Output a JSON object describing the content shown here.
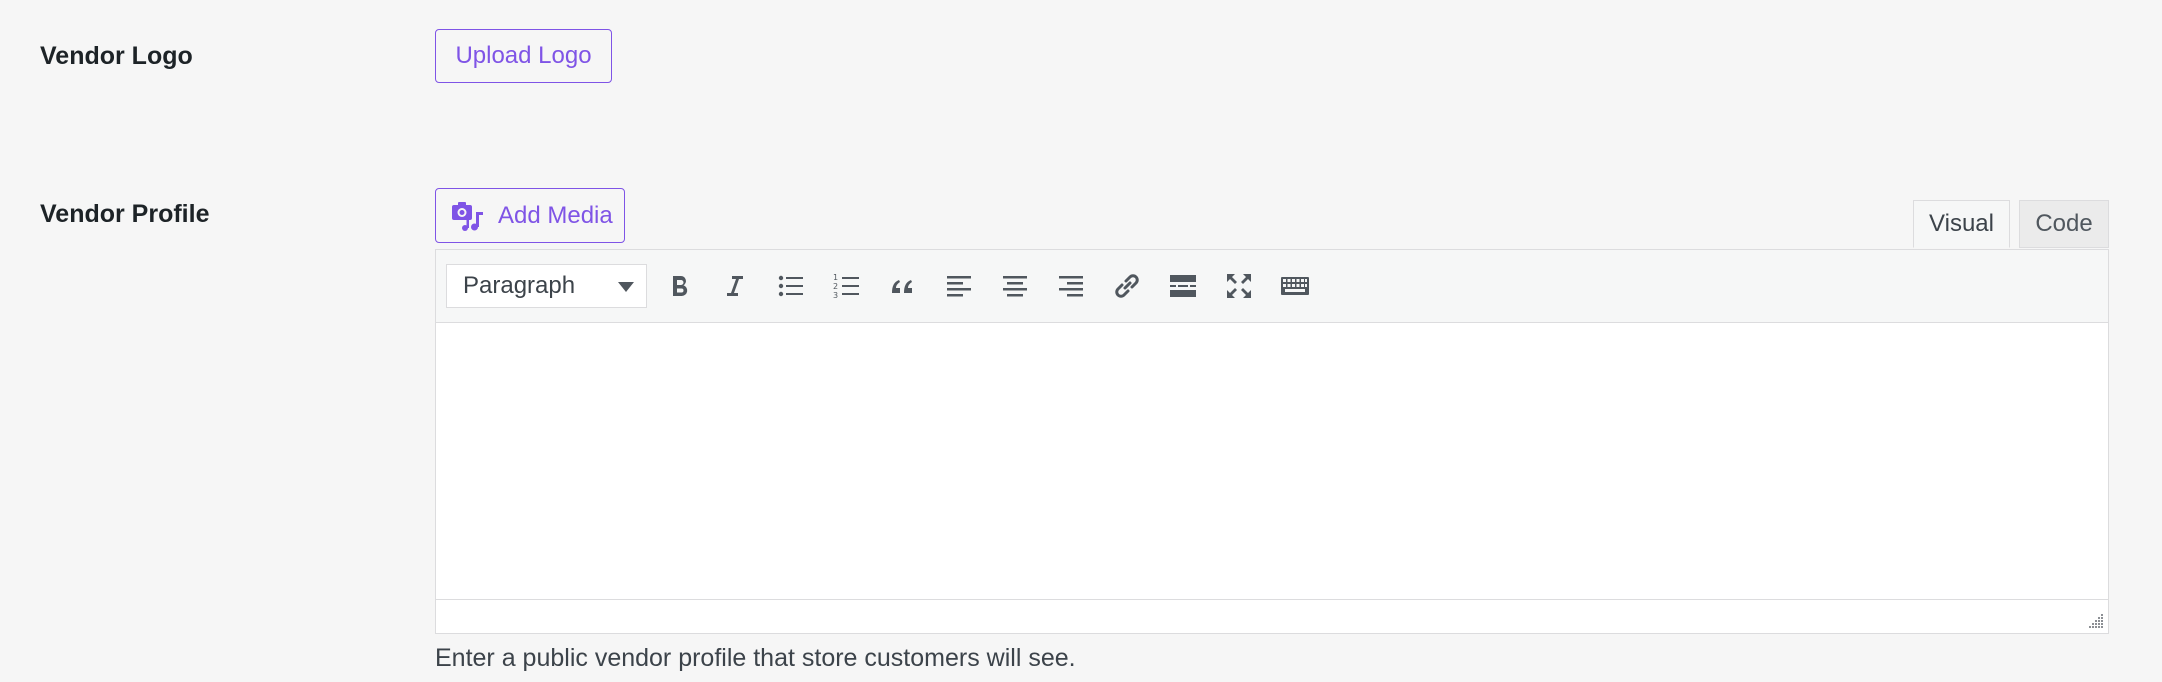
{
  "vendor_logo": {
    "label": "Vendor Logo",
    "upload_button": "Upload Logo"
  },
  "vendor_profile": {
    "label": "Vendor Profile",
    "add_media_button": "Add Media",
    "tabs": [
      {
        "label": "Visual",
        "active": true
      },
      {
        "label": "Code",
        "active": false
      }
    ],
    "toolbar": {
      "format_select_value": "Paragraph",
      "buttons": [
        "bold-icon",
        "italic-icon",
        "bullet-list-icon",
        "numbered-list-icon",
        "blockquote-icon",
        "align-left-icon",
        "align-center-icon",
        "align-right-icon",
        "link-icon",
        "read-more-icon",
        "fullscreen-icon",
        "toolbar-toggle-icon"
      ]
    },
    "editor_content": "",
    "help_text": "Enter a public vendor profile that store customers will see."
  },
  "colors": {
    "accent": "#7f54e6",
    "background": "#f6f6f6",
    "toolbar_icon": "#50575e"
  }
}
